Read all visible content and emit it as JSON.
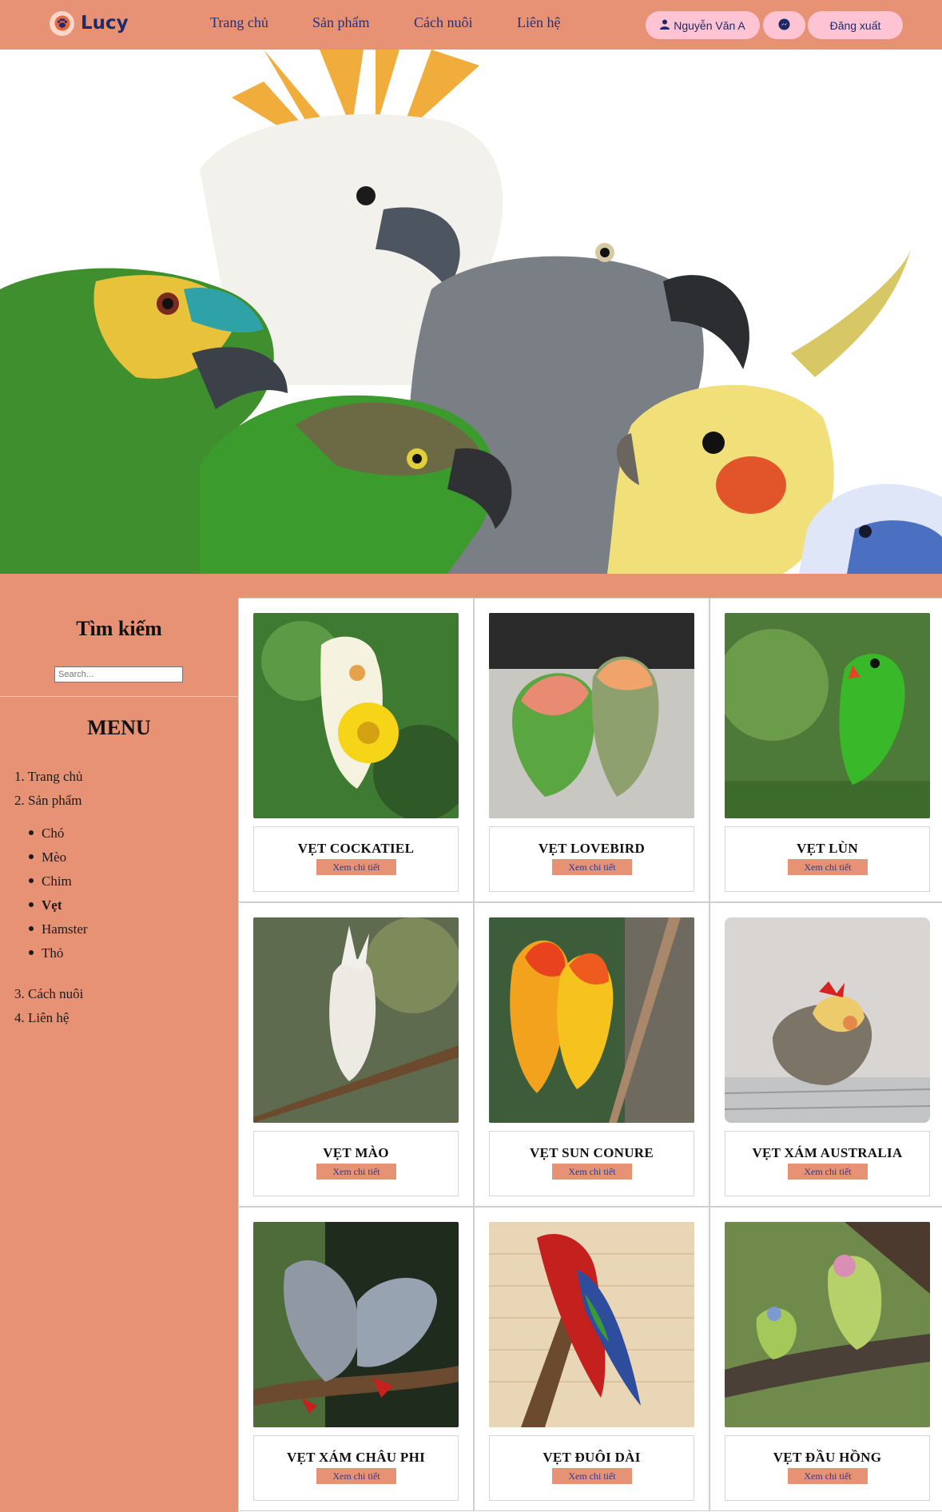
{
  "brand": {
    "name": "Lucy",
    "icon": "paw-icon",
    "accent": "#e89275"
  },
  "nav": {
    "links": [
      "Trang chủ",
      "Sản phẩm",
      "Cách nuôi",
      "Liên hệ"
    ],
    "user_label": "Nguyễn Văn A",
    "user_icon": "user-icon",
    "messenger_icon": "messenger-icon",
    "logout_label": "Đăng xuất"
  },
  "hero": {
    "image": "parrots-group-photo"
  },
  "sidebar": {
    "search_title": "Tìm kiếm",
    "search_placeholder": "Search...",
    "menu_title": "MENU",
    "menu": [
      {
        "num": "1.",
        "label": "Trang chủ"
      },
      {
        "num": "2.",
        "label": "Sản phẩm"
      },
      {
        "num": "3.",
        "label": "Cách nuôi"
      },
      {
        "num": "4.",
        "label": "Liên hệ"
      }
    ],
    "sub_items": [
      "Chó",
      "Mèo",
      "Chim",
      "Vẹt",
      "Hamster",
      "Thỏ"
    ],
    "active_sub": "Vẹt"
  },
  "products": [
    {
      "name": "VẸT COCKATIEL",
      "button": "Xem chi tiết"
    },
    {
      "name": "VẸT LOVEBIRD",
      "button": "Xem chi tiết"
    },
    {
      "name": "VẸT LÙN",
      "button": "Xem chi tiết"
    },
    {
      "name": "VẸT MÀO",
      "button": "Xem chi tiết"
    },
    {
      "name": "VẸT SUN CONURE",
      "button": "Xem chi tiết"
    },
    {
      "name": "VẸT XÁM AUSTRALIA",
      "button": "Xem chi tiết"
    },
    {
      "name": "VẸT XÁM CHÂU PHI",
      "button": "Xem chi tiết"
    },
    {
      "name": "VẸT ĐUÔI DÀI",
      "button": "Xem chi tiết"
    },
    {
      "name": "VẸT ĐẦU HỒNG",
      "button": "Xem chi tiết"
    }
  ]
}
